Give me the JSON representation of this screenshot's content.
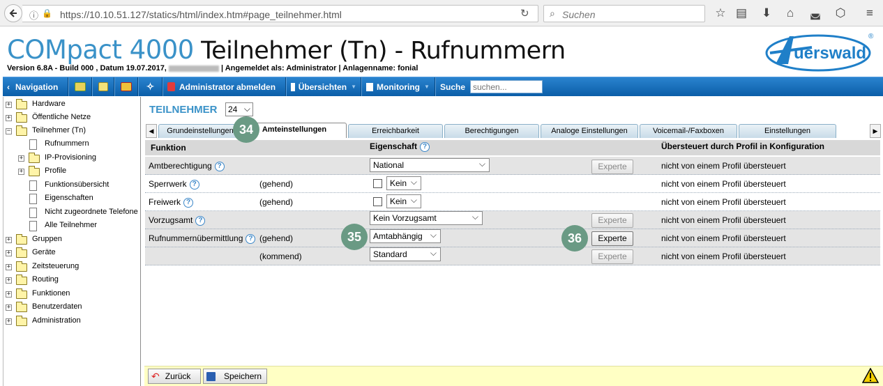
{
  "browser": {
    "url": "https://10.10.51.127/statics/html/index.htm#page_teilnehmer.html",
    "search_placeholder": "Suchen"
  },
  "header": {
    "product": "COMpact 4000",
    "page_title": "Teilnehmer (Tn) - Rufnummern",
    "version_line_a": "Version 6.8A - Build 000 ,  Datum 19.07.2017, ",
    "version_line_b": " | Angemeldet als: Administrator |  Anlagenname: fonial",
    "logo_text": "Auerswald"
  },
  "menu": {
    "navigation": "Navigation",
    "logout": "Administrator abmelden",
    "overview": "Übersichten",
    "monitoring": "Monitoring",
    "search_label": "Suche",
    "search_placeholder": "suchen..."
  },
  "tree": {
    "items": [
      {
        "label": "Hardware"
      },
      {
        "label": "Öffentliche Netze"
      },
      {
        "label": "Teilnehmer (Tn)"
      },
      {
        "label": "Rufnummern"
      },
      {
        "label": "IP-Provisioning"
      },
      {
        "label": "Profile"
      },
      {
        "label": "Funktionsübersicht"
      },
      {
        "label": "Eigenschaften"
      },
      {
        "label": "Nicht zugeordnete Telefone"
      },
      {
        "label": "Alle Teilnehmer"
      },
      {
        "label": "Gruppen"
      },
      {
        "label": "Geräte"
      },
      {
        "label": "Zeitsteuerung"
      },
      {
        "label": "Routing"
      },
      {
        "label": "Funktionen"
      },
      {
        "label": "Benutzerdaten"
      },
      {
        "label": "Administration"
      }
    ]
  },
  "main": {
    "title": "TEILNEHMER",
    "selected": "24",
    "tabs": [
      "Grundeinstellungen",
      "Amteinstellungen",
      "Erreichbarkeit",
      "Berechtigungen",
      "Analoge Einstellungen",
      "Voicemail-/Faxboxen",
      "Einstellungen"
    ],
    "columns": {
      "funktion": "Funktion",
      "eigenschaft": "Eigenschaft",
      "profil": "Übersteuert durch Profil in Konfiguration"
    },
    "rows": [
      {
        "label": "Amtberechtigung",
        "dir": "",
        "value": "National",
        "profile": "nicht von einem Profil übersteuert",
        "expert": "Experte"
      },
      {
        "label": "Sperrwerk",
        "dir": "(gehend)",
        "value": "Kein",
        "profile": "nicht von einem Profil übersteuert"
      },
      {
        "label": "Freiwerk",
        "dir": "(gehend)",
        "value": "Kein",
        "profile": "nicht von einem Profil übersteuert"
      },
      {
        "label": "Vorzugsamt",
        "dir": "",
        "value": "Kein Vorzugsamt",
        "profile": "nicht von einem Profil übersteuert",
        "expert": "Experte"
      },
      {
        "label": "Rufnummernübermittlung",
        "dir": "(gehend)",
        "value": "Amtabhängig",
        "profile": "nicht von einem Profil übersteuert",
        "expert": "Experte"
      },
      {
        "label": "",
        "dir": "(kommend)",
        "value": "Standard",
        "profile": "nicht von einem Profil übersteuert",
        "expert": "Experte"
      }
    ],
    "help_glyph": "?"
  },
  "badges": {
    "b34": "34",
    "b35": "35",
    "b36": "36"
  },
  "footer": {
    "back": "Zurück",
    "save": "Speichern"
  },
  "colors": {
    "menu_blue": "#0b5ea8",
    "brand_blue": "#3a92c8",
    "badge_green": "#6a9a84",
    "footer_yellow": "#ffffc4"
  }
}
